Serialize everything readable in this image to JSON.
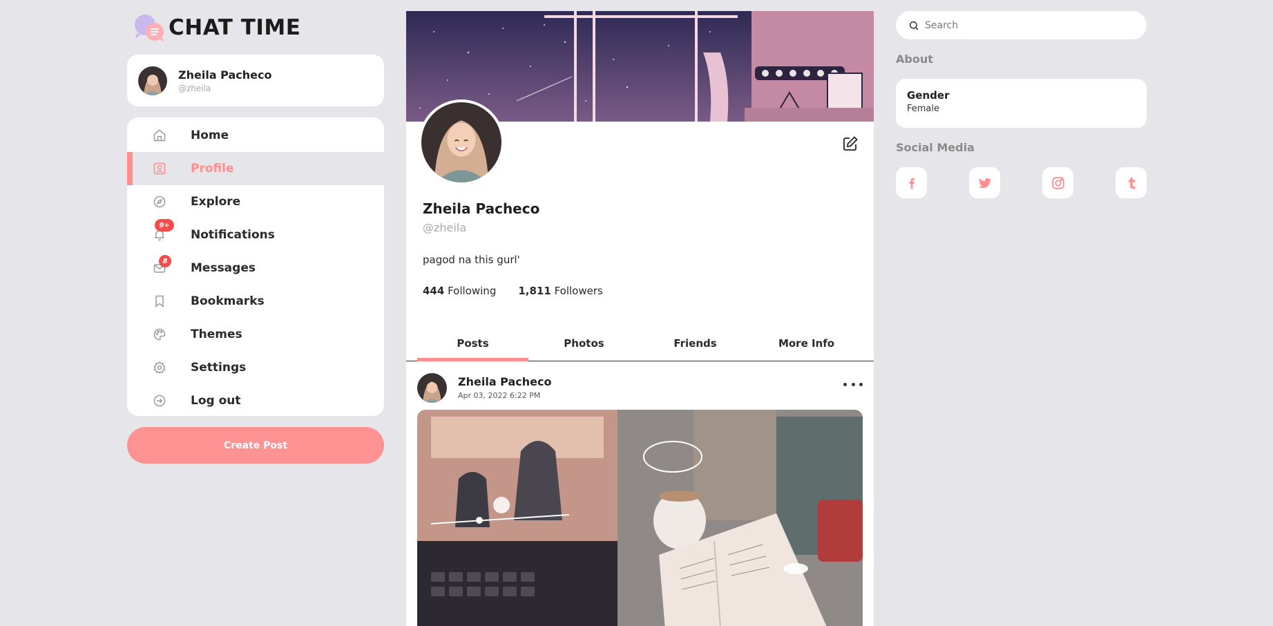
{
  "app": {
    "title": "CHAT TIME"
  },
  "current_user": {
    "name": "Zheila Pacheco",
    "handle": "@zheila"
  },
  "nav": {
    "items": [
      {
        "label": "Home",
        "icon": "home-icon"
      },
      {
        "label": "Profile",
        "icon": "profile-icon",
        "active": true
      },
      {
        "label": "Explore",
        "icon": "compass-icon"
      },
      {
        "label": "Notifications",
        "icon": "bell-icon",
        "badge": "9+"
      },
      {
        "label": "Messages",
        "icon": "mail-icon",
        "badge": "8"
      },
      {
        "label": "Bookmarks",
        "icon": "bookmark-icon"
      },
      {
        "label": "Themes",
        "icon": "palette-icon"
      },
      {
        "label": "Settings",
        "icon": "gear-icon"
      },
      {
        "label": "Log out",
        "icon": "logout-icon"
      }
    ],
    "create_post_label": "Create Post"
  },
  "profile": {
    "name": "Zheila Pacheco",
    "handle": "@zheila",
    "bio": "pagod na this gurl'",
    "following_count": "444",
    "following_label": "Following",
    "followers_count": "1,811",
    "followers_label": "Followers",
    "tabs": [
      {
        "label": "Posts",
        "active": true
      },
      {
        "label": "Photos"
      },
      {
        "label": "Friends"
      },
      {
        "label": "More Info"
      }
    ]
  },
  "post": {
    "author": "Zheila Pacheco",
    "date": "Apr 03, 2022 6:22 PM"
  },
  "sidebar_right": {
    "search_placeholder": "Search",
    "about_title": "About",
    "about": {
      "key": "Gender",
      "value": "Female"
    },
    "social_title": "Social Media",
    "socials": [
      "facebook-icon",
      "twitter-icon",
      "instagram-icon",
      "tumblr-icon"
    ]
  },
  "colors": {
    "accent": "#ff8e8e",
    "background": "#e5e5ea",
    "badge": "#f24c4c"
  }
}
